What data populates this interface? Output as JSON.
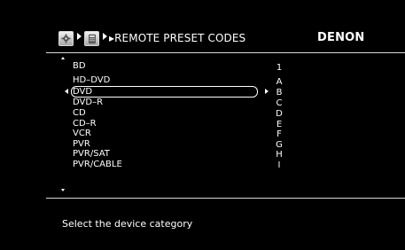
{
  "header": {
    "title": "▸REMOTE PRESET CODES",
    "brand": "DENON",
    "icons": [
      "gear-icon",
      "remote-control-icon"
    ]
  },
  "device_list": {
    "items": [
      {
        "label": "BD",
        "code": "1"
      },
      {
        "label": "HD–DVD",
        "code": "A"
      },
      {
        "label": "DVD",
        "code": "B",
        "selected": true
      },
      {
        "label": "DVD–R",
        "code": "C"
      },
      {
        "label": "CD",
        "code": "D"
      },
      {
        "label": "CD–R",
        "code": "E"
      },
      {
        "label": "VCR",
        "code": "F"
      },
      {
        "label": "PVR",
        "code": "G"
      },
      {
        "label": "PVR/SAT",
        "code": "H"
      },
      {
        "label": "PVR/CABLE",
        "code": "I"
      }
    ]
  },
  "footer": {
    "instruction": "Select the device category"
  },
  "colors": {
    "background": "#000000",
    "text": "#ffffff",
    "divider": "#d8d8d8"
  }
}
